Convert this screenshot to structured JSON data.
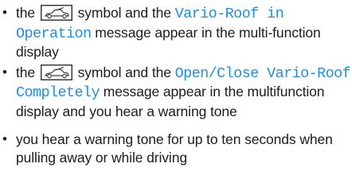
{
  "items": [
    {
      "before": "the",
      "symbol": "vario-roof-car-symbol",
      "mid": "symbol and the",
      "code": "Vario-Roof in Operation",
      "after": "message appear in the multi-function display"
    },
    {
      "before": "the",
      "symbol": "vario-roof-car-symbol",
      "mid": "symbol and the",
      "code": "Open/Close Vario-Roof Completely",
      "after": "message appear in the multifunction display and you hear a warning tone"
    },
    {
      "text": "you hear a warning tone for up to ten seconds when pulling away or while driving"
    }
  ],
  "colors": {
    "text": "#1c1c1c",
    "display_message": "#1e8fe6"
  }
}
